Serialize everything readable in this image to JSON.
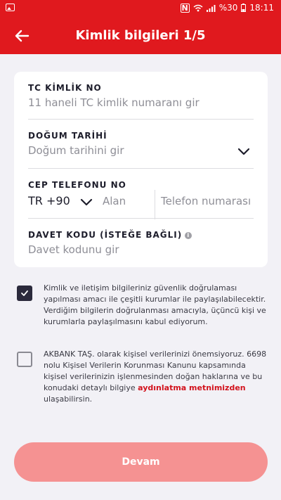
{
  "status_bar": {
    "battery": "%30",
    "time": "18:11",
    "icons": [
      "image-icon",
      "nfc-icon",
      "wifi-icon",
      "signal-icon",
      "battery-icon"
    ]
  },
  "header": {
    "title": "Kimlik bilgileri 1/5",
    "back_icon": "arrow-left-icon",
    "background": "#e0191e"
  },
  "form": {
    "tc": {
      "label": "TC KİMLİK NO",
      "placeholder": "11 haneli TC kimlik numaranı gir"
    },
    "birth": {
      "label": "DOĞUM TARİHİ",
      "placeholder": "Doğum tarihini gir",
      "icon": "chevron-down-icon"
    },
    "phone": {
      "label": "CEP TELEFONU NO",
      "country_code": "TR +90",
      "area_placeholder": "Alan",
      "number_placeholder": "Telefon numarası"
    },
    "invite": {
      "label": "DAVET KODU (İSTEĞE BAĞLI)",
      "placeholder": "Davet kodunu gir",
      "icon": "info-icon"
    }
  },
  "consents": [
    {
      "checked": true,
      "text": "Kimlik ve iletişim bilgileriniz güvenlik doğrulaması yapılması amacı ile çeşitli kurumlar ile paylaşılabilecektir. Verdiğim bilgilerin doğrulanması amacıyla, üçüncü kişi ve kurumlarla paylaşılmasını kabul ediyorum."
    },
    {
      "checked": false,
      "text_before": "AKBANK TAŞ. olarak kişisel verilerinizi önemsiyoruz. 6698 nolu Kişisel Verilerin Korunması Kanunu kapsamında kişisel verilerinizin işlenmesinden doğan haklarına ve bu konudaki detaylı bilgiye ",
      "link": "aydınlatma metnimizden",
      "text_after": " ulaşabilirsin."
    }
  ],
  "continue_button": {
    "label": "Devam",
    "color": "#f59292"
  }
}
